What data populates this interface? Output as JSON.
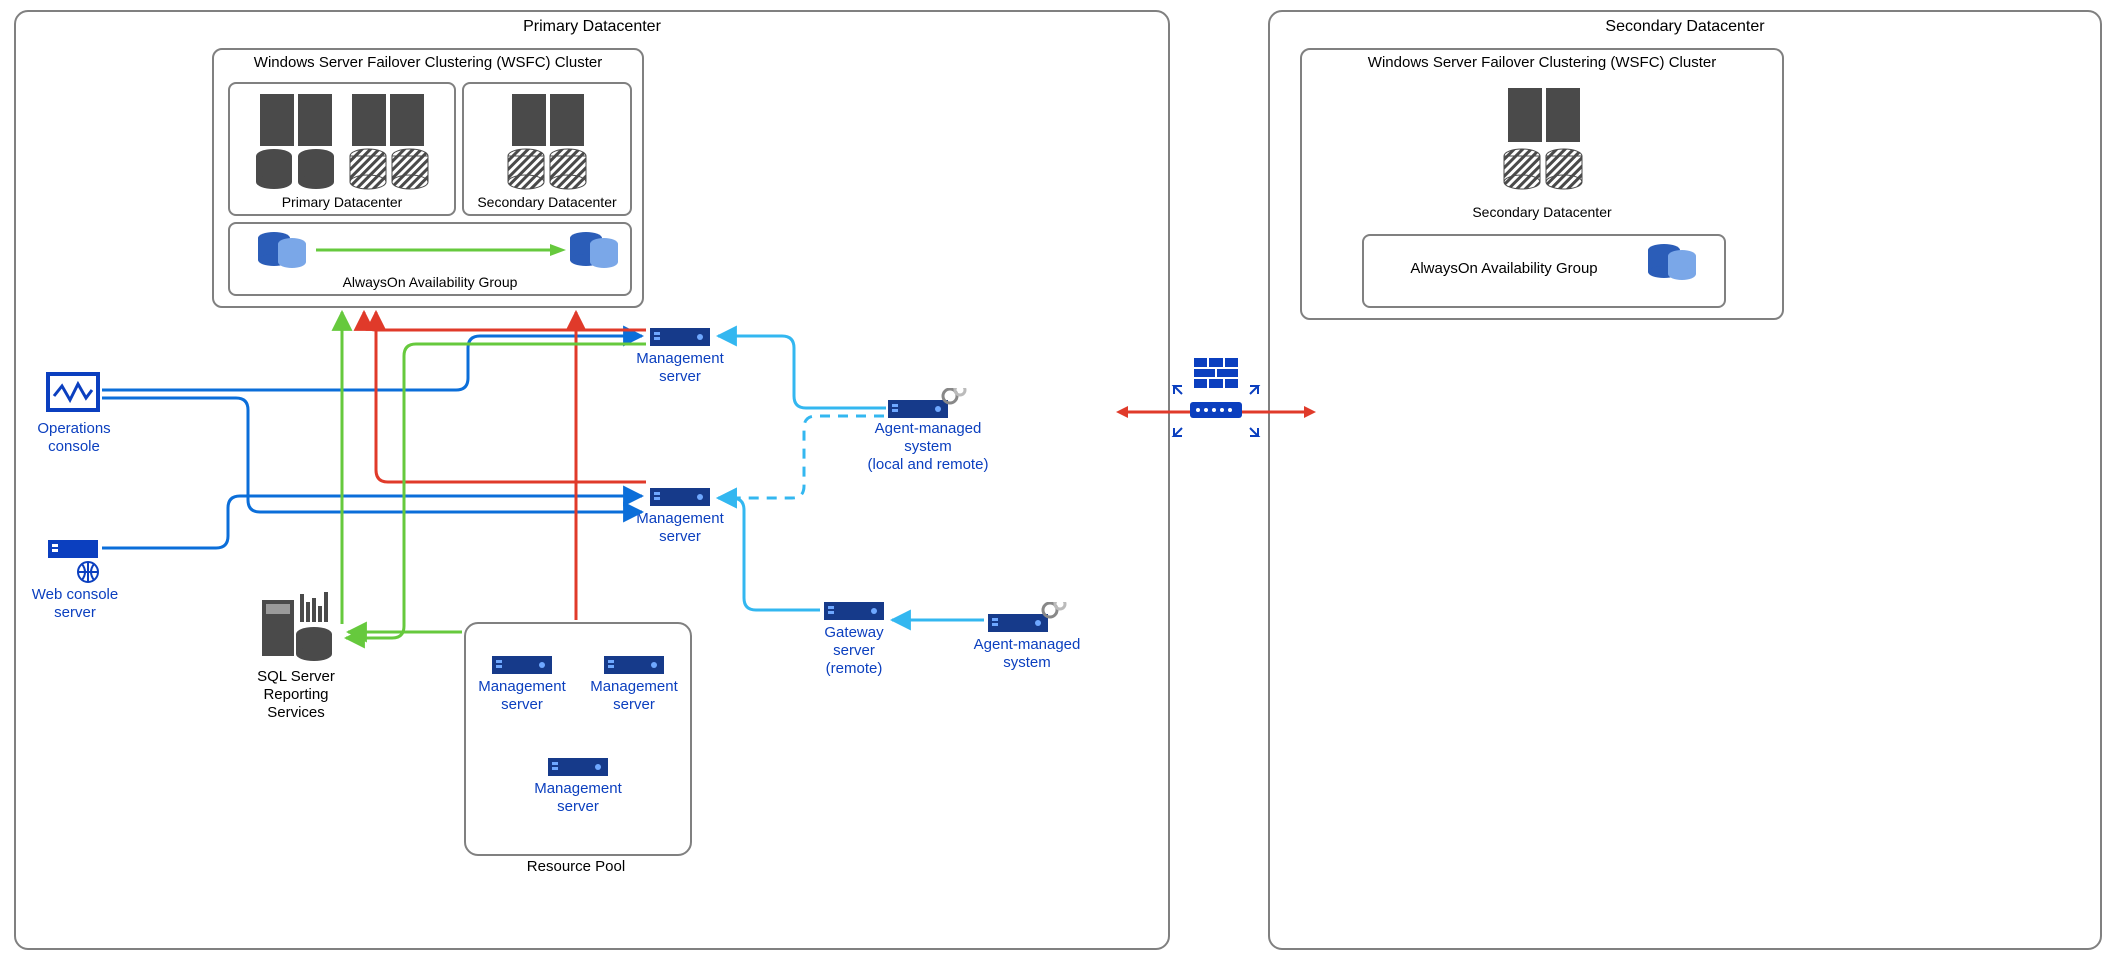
{
  "primary": {
    "title": "Primary Datacenter",
    "wsfc_title": "Windows Server Failover Clustering (WSFC) Cluster",
    "sub_primary": "Primary Datacenter",
    "sub_secondary": "Secondary Datacenter",
    "ag_title": "AlwaysOn Availability Group"
  },
  "secondary": {
    "title": "Secondary Datacenter",
    "wsfc_title": "Windows Server Failover Clustering (WSFC) Cluster",
    "sub_secondary": "Secondary Datacenter",
    "ag_title": "AlwaysOn Availability Group"
  },
  "labels": {
    "ops_console": "Operations console",
    "web_console": "Web console server",
    "ssrs": "SQL Server\nReporting Services",
    "mgmt_server": "Management server",
    "resource_pool": "Resource Pool",
    "agent_local": "Agent-managed system\n(local and remote)",
    "gateway": "Gateway server\n(remote)",
    "agent_system": "Agent-managed system"
  }
}
